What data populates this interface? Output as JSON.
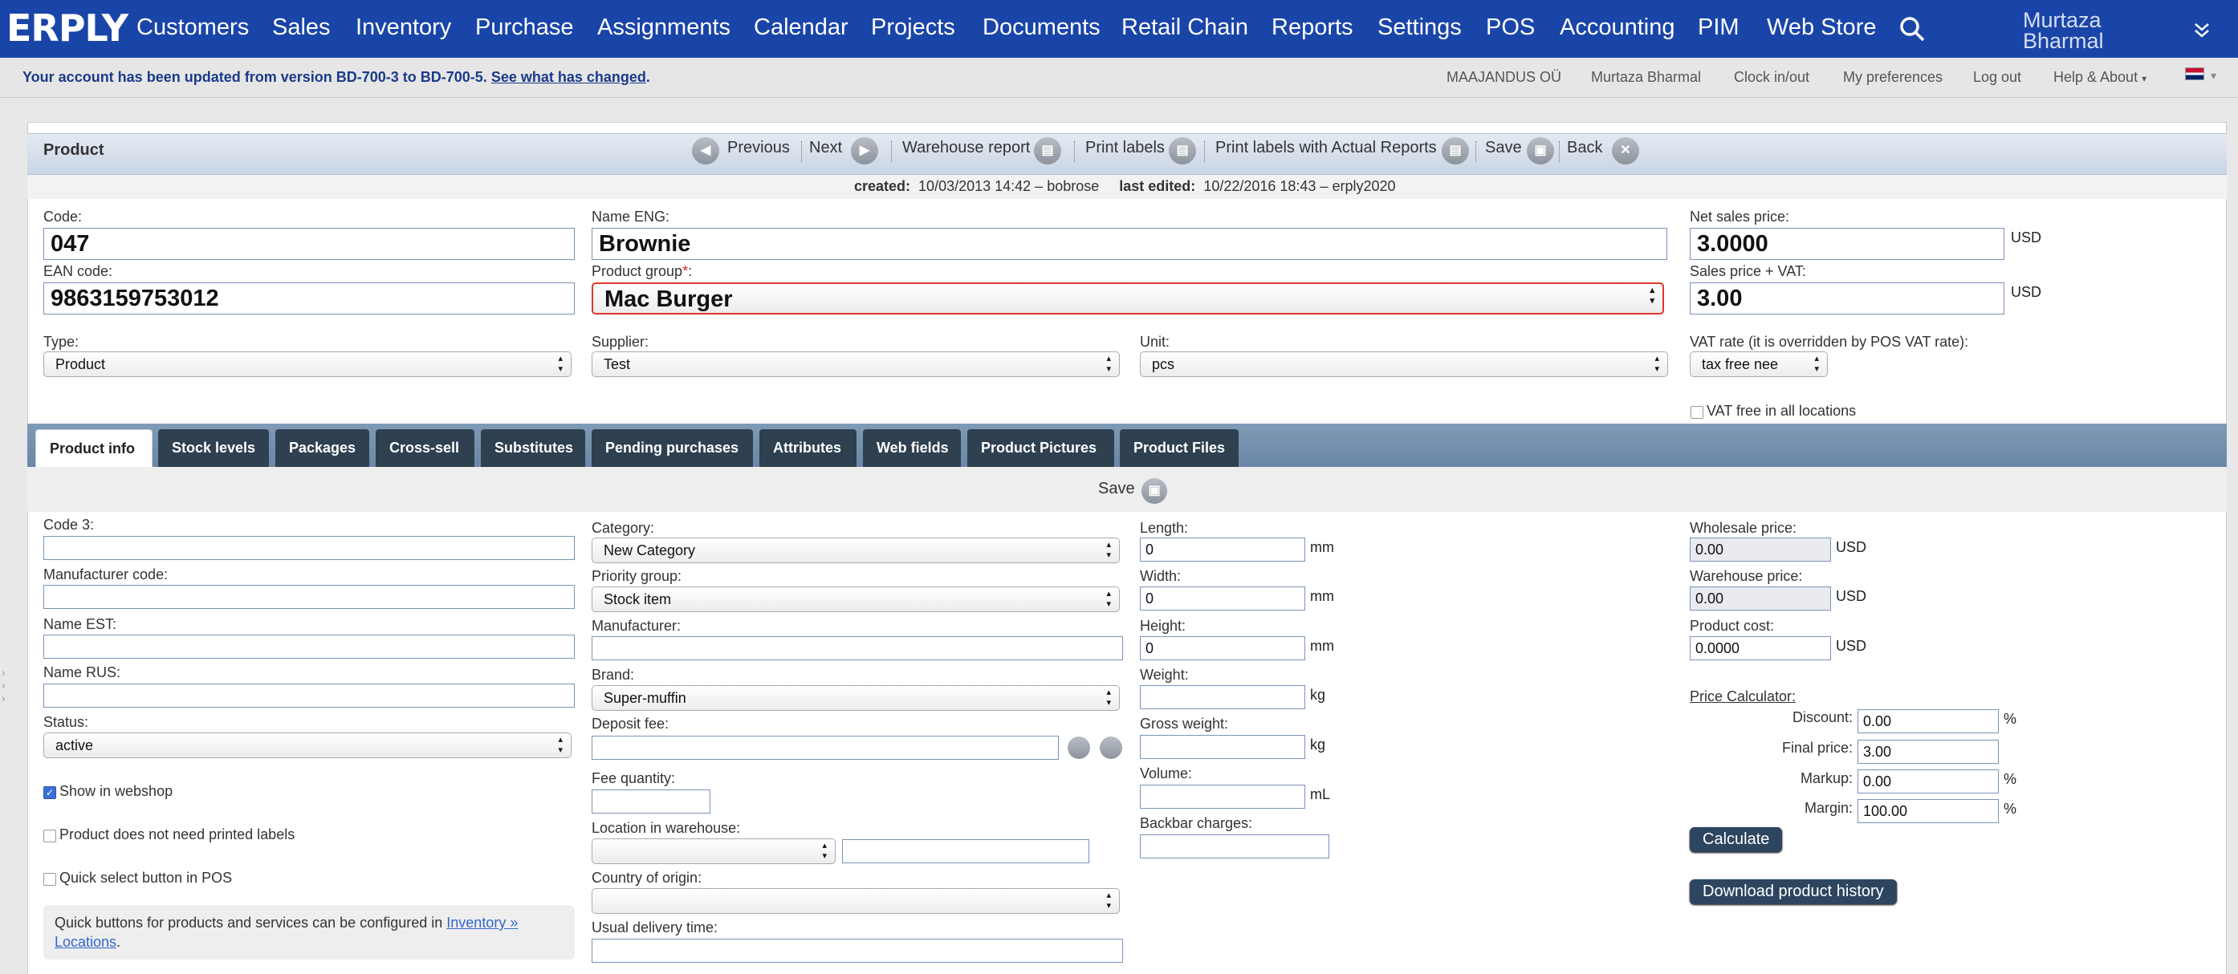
{
  "nav": {
    "logo": "ERPLY",
    "items": [
      "Customers",
      "Sales",
      "Inventory",
      "Purchase",
      "Assignments",
      "Calendar",
      "Projects",
      "Documents",
      "Retail Chain",
      "Reports",
      "Settings",
      "POS",
      "Accounting",
      "PIM",
      "Web Store"
    ],
    "user": "Murtaza Bharmal"
  },
  "infobar": {
    "message": "Your account has been updated from version BD-700-3 to BD-700-5.",
    "link": "See what has changed",
    "suffix": ".",
    "company": "MAAJANDUS OÜ",
    "user": "Murtaza Bharmal",
    "clock": "Clock in/out",
    "prefs": "My preferences",
    "logout": "Log out",
    "help": "Help & About",
    "help_caret": "▾"
  },
  "toolbar": {
    "title": "Product",
    "previous": "Previous",
    "next": "Next",
    "warehouse_report": "Warehouse report",
    "print_labels": "Print labels",
    "print_labels_actual": "Print labels with Actual Reports",
    "save": "Save",
    "back": "Back"
  },
  "meta": {
    "created_label": "created:",
    "created_value": "10/03/2013 14:42 – bobrose",
    "edited_label": "last edited:",
    "edited_value": "10/22/2016 18:43 – erply2020"
  },
  "form": {
    "code_label": "Code:",
    "code": "047",
    "ean_label": "EAN code:",
    "ean": "9863159753012",
    "name_label": "Name ENG:",
    "name": "Brownie",
    "group_label": "Product group",
    "group_required": "*",
    "group_colon": ":",
    "group": "Mac Burger",
    "net_label": "Net sales price:",
    "net": "3.0000",
    "currency": "USD",
    "vat_price_label": "Sales price + VAT:",
    "vat_price": "3.00",
    "type_label": "Type:",
    "type": "Product",
    "supplier_label": "Supplier:",
    "supplier": "Test",
    "unit_label": "Unit:",
    "unit": "pcs",
    "vat_rate_label": "VAT rate (it is overridden by POS VAT rate):",
    "vat_rate": "tax free nee",
    "vat_free_label": "VAT free in all locations"
  },
  "tabs": [
    "Product info",
    "Stock levels",
    "Packages",
    "Cross-sell",
    "Substitutes",
    "Pending purchases",
    "Attributes",
    "Web fields",
    "Product Pictures",
    "Product Files"
  ],
  "savebar": {
    "save": "Save"
  },
  "info": {
    "code3_label": "Code 3:",
    "code3": "",
    "mfr_code_label": "Manufacturer code:",
    "mfr_code": "",
    "name_est_label": "Name EST:",
    "name_est": "",
    "name_rus_label": "Name RUS:",
    "name_rus": "",
    "status_label": "Status:",
    "status": "active",
    "webshop_label": "Show in webshop",
    "no_labels_label": "Product does not need printed labels",
    "quick_select_label": "Quick select button in POS",
    "note_text": "Quick buttons for products and services can be configured in ",
    "note_link": "Inventory » Locations",
    "note_end": ".",
    "category_label": "Category:",
    "category": "New Category",
    "priority_label": "Priority group:",
    "priority": "Stock item",
    "manufacturer_label": "Manufacturer:",
    "manufacturer": "",
    "brand_label": "Brand:",
    "brand": "Super-muffin",
    "deposit_label": "Deposit fee:",
    "deposit": "",
    "fee_qty_label": "Fee quantity:",
    "fee_qty": "",
    "location_label": "Location in warehouse:",
    "location": "",
    "location_text": "",
    "origin_label": "Country of origin:",
    "origin": "",
    "delivery_label": "Usual delivery time:",
    "delivery": "",
    "length_label": "Length:",
    "length": "0",
    "width_label": "Width:",
    "width": "0",
    "height_label": "Height:",
    "height": "0",
    "mm": "mm",
    "kg": "kg",
    "ml": "mL",
    "weight_label": "Weight:",
    "weight": "",
    "gross_label": "Gross weight:",
    "gross": "",
    "volume_label": "Volume:",
    "volume": "",
    "backbar_label": "Backbar charges:",
    "backbar": "",
    "wholesale_label": "Wholesale price:",
    "wholesale": "0.00",
    "warehouse_label": "Warehouse price:",
    "warehouse": "0.00",
    "cost_label": "Product cost:",
    "cost": "0.0000",
    "currency": "USD",
    "calc_label": "Price Calculator:",
    "discount_label": "Discount:",
    "discount": "0.00",
    "final_label": "Final price:",
    "final": "3.00",
    "markup_label": "Markup:",
    "markup": "0.00",
    "margin_label": "Margin:",
    "margin": "100.00",
    "percent": "%",
    "calculate": "Calculate",
    "download_history": "Download product history"
  },
  "colors": {
    "nav": "#1a45a8",
    "tab": "#2f4050",
    "accent": "#3b6fd6"
  }
}
